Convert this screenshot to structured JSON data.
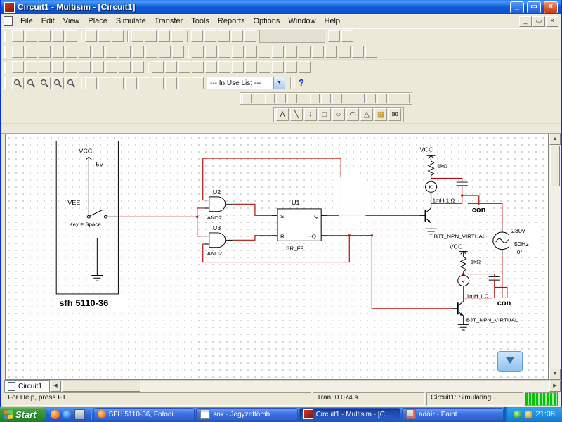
{
  "window": {
    "title": "Circuit1 - Multisim - [Circuit1]",
    "controls": {
      "minimize": "_",
      "restore": "▭",
      "close": "×"
    },
    "mdi_controls": {
      "minimize": "_",
      "restore": "▭",
      "close": "×"
    },
    "menus": [
      "File",
      "Edit",
      "View",
      "Place",
      "Simulate",
      "Transfer",
      "Tools",
      "Reports",
      "Options",
      "Window",
      "Help"
    ]
  },
  "toolbars": {
    "in_use_list": "--- In Use List ---",
    "dropdown_arrow": "▼",
    "help": "?",
    "drawing": [
      "A",
      "╲",
      "≀",
      "□",
      "○",
      "◠",
      "△",
      "▦",
      "✉"
    ]
  },
  "schematic": {
    "labels": {
      "vcc_left": "VCC",
      "v5": "5V",
      "vee": "VEE",
      "key": "Key = Space",
      "part": "sfh 5110-36",
      "u2": "U2",
      "u2_type": "AND2",
      "u3": "U3",
      "u3_type": "AND2",
      "u1": "U1",
      "u1_type": "SR_FF",
      "pin_s": "S",
      "pin_r": "R",
      "pin_q": "Q",
      "pin_qn": "~Q",
      "vcc_top": "VCC",
      "r_top": "1kΩ",
      "k_top": "K",
      "l_top": "1mH 1 Ω",
      "bjt_top": "BJT_NPN_VIRTUAL",
      "con_top": "con",
      "src_v": "230v",
      "src_f": "50Hz",
      "src_ph": "0°",
      "vcc_bot": "VCC",
      "r_bot": "1kΩ",
      "k_bot": "K",
      "l_bot": "1mH 1 Ω",
      "bjt_bot": "BJT_NPN_VIRTUAL",
      "con_bot": "con"
    }
  },
  "scroll": {
    "up": "▲",
    "down": "▼",
    "left": "◀",
    "right": "▶"
  },
  "tab": {
    "label": "Circuit1"
  },
  "status": {
    "help": "For Help, press F1",
    "tran": "Tran: 0.074 s",
    "sim": "Circuit1: Simulating..."
  },
  "taskbar": {
    "start": "Start",
    "tasks": [
      {
        "label": "SFH 5110-36, Fotodi..."
      },
      {
        "label": "sok - Jegyzettömb"
      },
      {
        "label": "Circuit1 - Multisim - [C..."
      },
      {
        "label": "adóír - Paint"
      }
    ],
    "clock": "21:08"
  }
}
